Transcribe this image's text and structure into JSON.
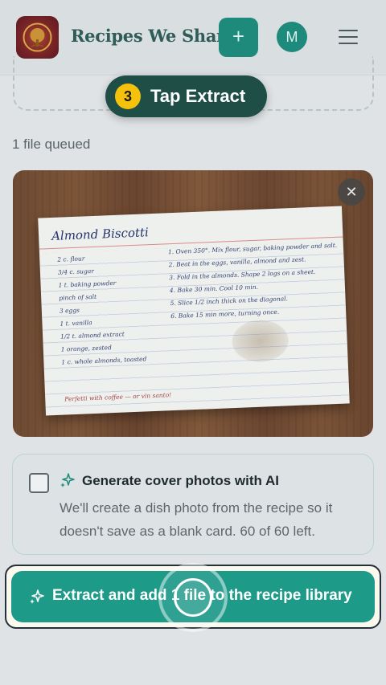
{
  "header": {
    "app_title": "Recipes We Share",
    "add_label": "+",
    "avatar_initial": "M",
    "logo_icon": "tree-logo-icon",
    "menu_icon": "hamburger-menu-icon"
  },
  "tutorial": {
    "step_number": "3",
    "step_label": "Tap Extract"
  },
  "queue": {
    "status": "1 file queued",
    "close_icon": "close-icon",
    "close_label": "✕"
  },
  "recipe_card": {
    "title": "Almond Biscotti",
    "ingredients": [
      "2 c. flour",
      "3/4 c. sugar",
      "1 t. baking powder",
      "pinch of salt",
      "3 eggs",
      "1 t. vanilla",
      "1/2 t. almond extract",
      "1 orange, zested",
      "1 c. whole almonds, toasted"
    ],
    "steps": [
      "1. Oven 350°. Mix flour, sugar, baking powder and salt.",
      "2. Beat in the eggs, vanilla, almond and zest.",
      "3. Fold in the almonds. Shape 2 logs on a sheet.",
      "4. Bake 30 min. Cool 10 min.",
      "5. Slice 1/2 inch thick on the diagonal.",
      "6. Bake 15 min more, turning once."
    ],
    "note": "Perfetti with coffee — or vin santo!"
  },
  "ai_option": {
    "checked": false,
    "icon": "sparkle-icon",
    "title": "Generate cover photos with AI",
    "description": "We'll create a dish photo from the recipe so it doesn't save as a blank card. 60 of 60 left."
  },
  "extract": {
    "icon": "sparkle-icon",
    "label": "Extract and add 1 file to the recipe library"
  },
  "colors": {
    "brand_teal": "#1e8a7c",
    "button_teal": "#1e9a89",
    "step_pill": "#1f4e47",
    "step_badge": "#f4c20d"
  }
}
